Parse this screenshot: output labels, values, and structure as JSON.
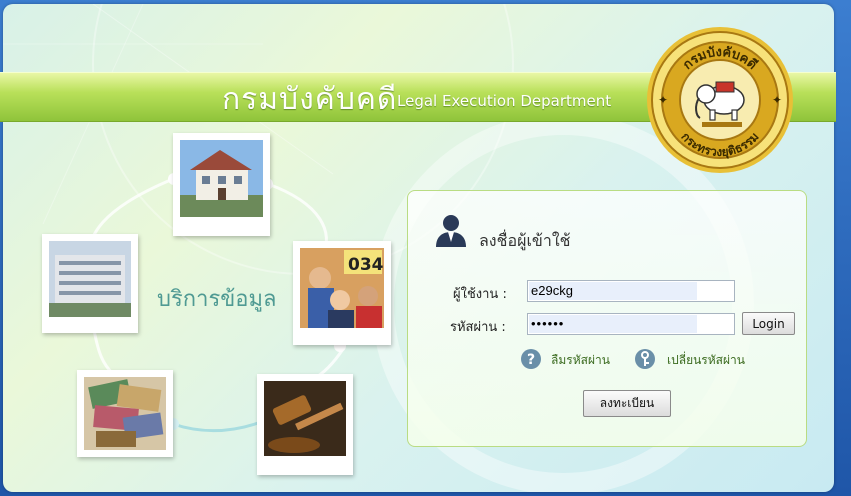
{
  "header": {
    "title_th": "กรมบังคับคดี",
    "title_en": "Legal Execution Department",
    "seal": {
      "top_text": "กรมบังคับคดี",
      "bottom_text": "กระทรวงยุติธรรม"
    }
  },
  "left": {
    "services_label": "บริการข้อมูล",
    "photo_sign_text": "034"
  },
  "login": {
    "title": "ลงชื่อผู้เข้าใช้",
    "username_label": "ผู้ใช้งาน :",
    "username_value": "e29ckg",
    "password_label": "รหัสผ่าน :",
    "password_value": "••••••",
    "login_button": "Login",
    "forgot_password": "ลืมรหัสผ่าน",
    "change_password": "เปลี่ยนรหัสผ่าน",
    "register_button": "ลงทะเบียน"
  },
  "colors": {
    "banner": "#9fd046",
    "accent_green": "#3a6a1e",
    "frame_blue": "#2a5ea8",
    "seal_gold": "#d9a820"
  }
}
